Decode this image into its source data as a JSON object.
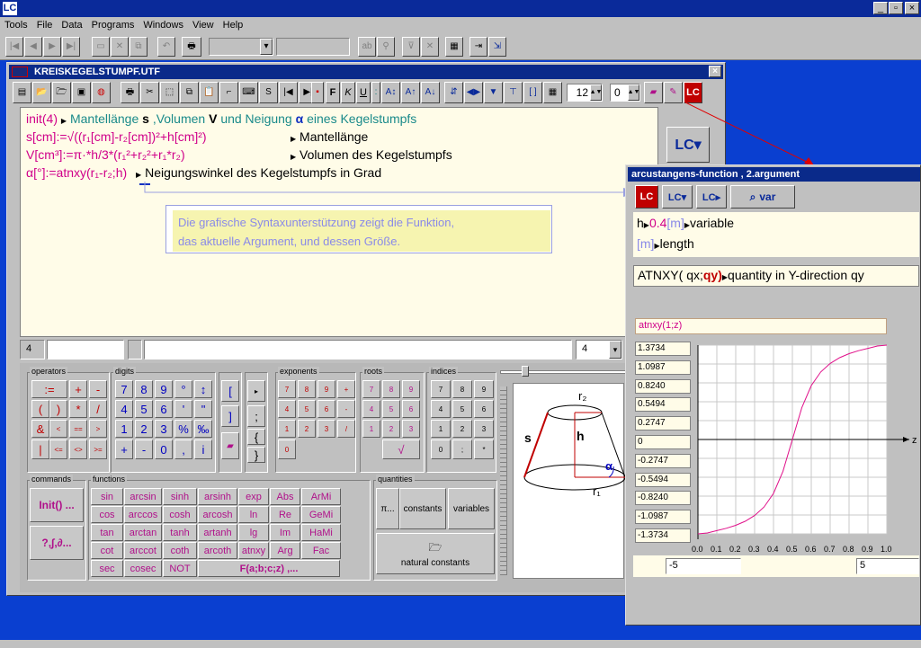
{
  "app": {
    "menu": [
      "Tools",
      "File",
      "Data",
      "Programs",
      "Windows",
      "View",
      "Help"
    ],
    "title_buttons": [
      "_",
      "▫",
      "×"
    ]
  },
  "document": {
    "title": "KREISKEGELSTUMPF.UTF",
    "font_size": "12",
    "index_value": "0",
    "lines": {
      "l1_func": "init(4)",
      "l1_text_a": "Mantellänge",
      "l1_s": "s",
      "l1_text_b": ",Volumen",
      "l1_v": "V",
      "l1_text_c": "und Neigung",
      "l1_alpha": "α",
      "l1_text_d": "eines Kegelstumpfs",
      "l2_expr": "s[cm]:=√((r₁[cm]-r₂[cm])²+h[cm]²)",
      "l2_comment": "Mantellänge",
      "l3_expr": "V[cm³]:=π·*h/3*(r₁²+r₂²+r₁*r₂)",
      "l3_comment": "Volumen des Kegelstumpfs",
      "l4_expr": "α[°]:=atnxy(r₁-r₂;h)",
      "l4_comment": "Neigungswinkel des Kegelstumpfs in Grad"
    },
    "tooltip_line1": "Die grafische Syntaxunterstützung zeigt die Funktion,",
    "tooltip_line2": "das aktuelle Argument, und dessen Größe.",
    "status_left": "4",
    "status_right": "4"
  },
  "palettes": {
    "operators_label": "operators",
    "operators": [
      ":=",
      "+",
      "-",
      "(",
      ")",
      "*",
      "/",
      "&",
      "<",
      "==",
      ">",
      "|",
      "<=",
      "<>",
      ">="
    ],
    "digits_label": "digits",
    "digits": [
      "7",
      "8",
      "9",
      "°",
      "↕",
      "4",
      "5",
      "6",
      "'",
      "\"",
      "1",
      "2",
      "3",
      "%",
      "‰",
      "+",
      "-",
      "0",
      ",",
      "i"
    ],
    "exponents_label": "exponents",
    "exponents": [
      "7",
      "8",
      "9",
      "+",
      "4",
      "5",
      "6",
      "-",
      "1",
      "2",
      "3",
      "/",
      "0"
    ],
    "roots_label": "roots",
    "roots": [
      "7",
      "8",
      "9",
      "4",
      "5",
      "6",
      "1",
      "2",
      "3",
      "√"
    ],
    "indices_label": "indices",
    "indices": [
      "7",
      "8",
      "9",
      "4",
      "5",
      "6",
      "1",
      "2",
      "3",
      "0",
      ";",
      "*"
    ],
    "commands_label": "commands",
    "commands": [
      "Init() ...",
      "?,∫,∂..."
    ],
    "functions_label": "functions",
    "functions": [
      "sin",
      "arcsin",
      "sinh",
      "arsinh",
      "exp",
      "Abs",
      "ArMi",
      "cos",
      "arccos",
      "cosh",
      "arcosh",
      "ln",
      "Re",
      "GeMi",
      "tan",
      "arctan",
      "tanh",
      "artanh",
      "lg",
      "Im",
      "HaMi",
      "cot",
      "arccot",
      "coth",
      "arcoth",
      "atnxy",
      "Arg",
      "Fac",
      "sec",
      "cosec",
      "NOT",
      "F(a;b;c;z) ,..."
    ],
    "quantities_label": "quantities",
    "quantities": [
      "π...",
      "constants",
      "variables",
      "natural constants"
    ]
  },
  "diagram": {
    "labels": [
      "r₂",
      "s",
      "h",
      "α",
      "r₁"
    ]
  },
  "side": {
    "title": "arcustangens-function , 2.argument",
    "var_button": "var",
    "line1_h": "h",
    "line1_val": "0.4",
    "line1_unit": "[m]",
    "line1_desc": "variable",
    "line2_unit": "[m]",
    "line2_desc": "length",
    "signature_a": "ATNXY( qx;",
    "signature_b": "qy)",
    "signature_c": "quantity in Y-direction qy",
    "plot_expr": "atnxy(1;z)",
    "range_min": "-5",
    "range_max": "5",
    "axis_name": "z"
  },
  "chart_data": {
    "type": "line",
    "title": "atnxy(1;z)",
    "xlabel": "z",
    "ylabel": "",
    "x_ticks": [
      "0.0",
      "0.1",
      "0.2",
      "0.3",
      "0.4",
      "0.5",
      "0.6",
      "0.7",
      "0.8",
      "0.9",
      "1.0"
    ],
    "y_ticks": [
      "1.3734",
      "1.0987",
      "0.8240",
      "0.5494",
      "0.2747",
      "0",
      "-0.2747",
      "-0.5494",
      "-0.8240",
      "-1.0987",
      "-1.3734"
    ],
    "xlim": [
      0,
      1
    ],
    "ylim": [
      -1.3734,
      1.3734
    ],
    "grid": true,
    "series": [
      {
        "x": [
          0,
          0.05,
          0.1,
          0.15,
          0.2,
          0.25,
          0.3,
          0.35,
          0.4,
          0.45,
          0.5,
          0.55,
          0.6,
          0.65,
          0.7,
          0.75,
          0.8,
          0.85,
          0.9,
          0.95,
          1.0
        ],
        "y": [
          -1.3734,
          -1.3597,
          -1.3258,
          -1.2925,
          -1.249,
          -1.1903,
          -1.1071,
          -0.9828,
          -0.7854,
          -0.4636,
          0,
          0.4636,
          0.7854,
          0.9828,
          1.1071,
          1.1903,
          1.249,
          1.2925,
          1.3258,
          1.3597,
          1.3734
        ],
        "color": "#e0108a"
      }
    ]
  }
}
